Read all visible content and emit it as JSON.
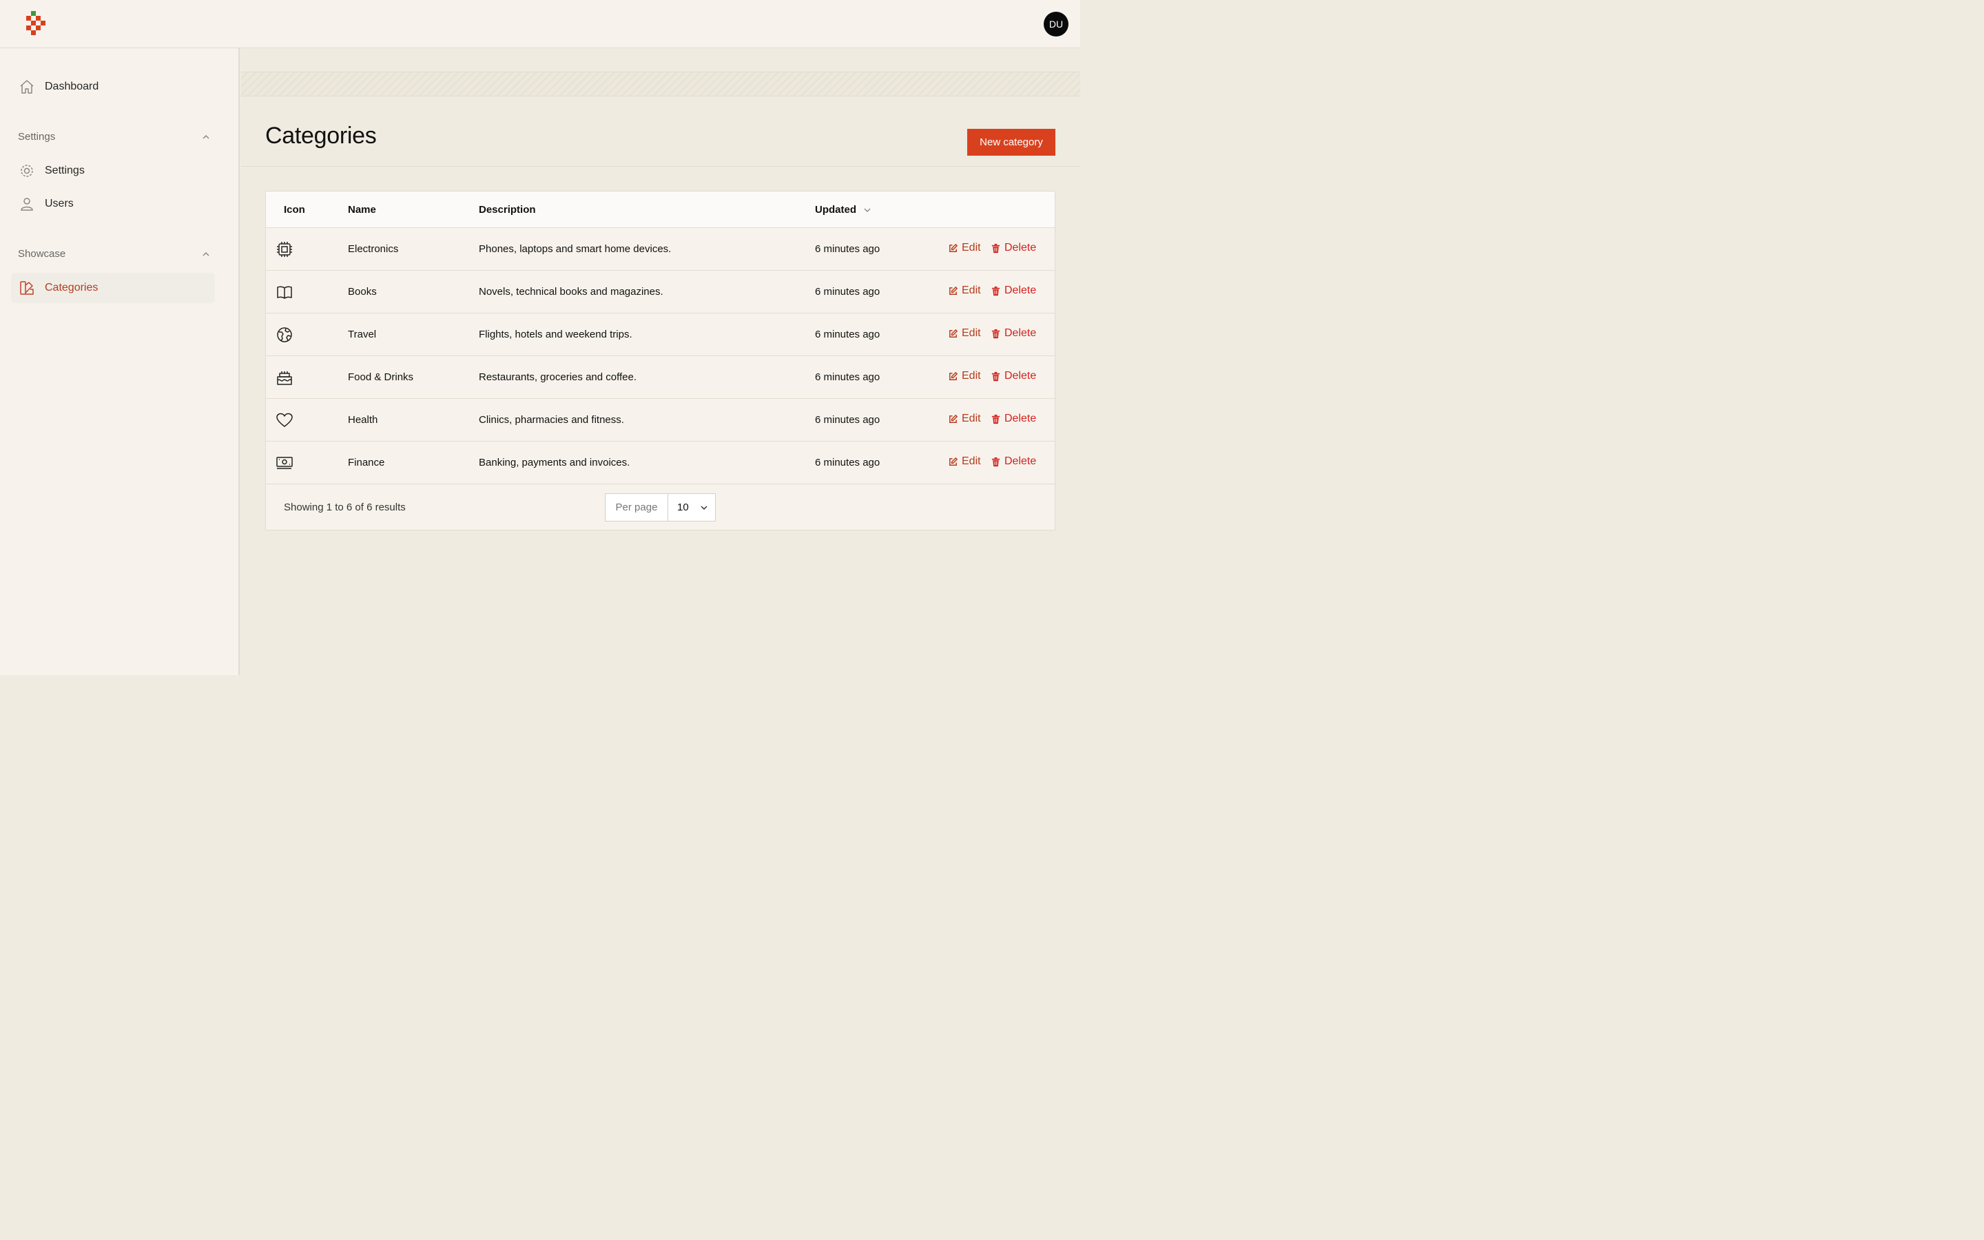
{
  "header": {
    "avatar_initials": "DU"
  },
  "sidebar": {
    "dashboard_label": "Dashboard",
    "groups": [
      {
        "label": "Settings",
        "items": [
          "Settings",
          "Users"
        ]
      },
      {
        "label": "Showcase",
        "items": [
          "Categories"
        ]
      }
    ],
    "active_item": "Categories"
  },
  "page": {
    "title": "Categories",
    "new_button": "New category"
  },
  "table": {
    "columns": [
      "Icon",
      "Name",
      "Description",
      "Updated"
    ],
    "sort_icon": "chevron-down-icon",
    "rows": [
      {
        "icon": "chip-icon",
        "name": "Electronics",
        "description": "Phones, laptops and smart home devices.",
        "updated": "6 minutes ago",
        "edit": "Edit",
        "delete": "Delete"
      },
      {
        "icon": "book-icon",
        "name": "Books",
        "description": "Novels, technical books and magazines.",
        "updated": "6 minutes ago",
        "edit": "Edit",
        "delete": "Delete"
      },
      {
        "icon": "globe-icon",
        "name": "Travel",
        "description": "Flights, hotels and weekend trips.",
        "updated": "6 minutes ago",
        "edit": "Edit",
        "delete": "Delete"
      },
      {
        "icon": "cake-icon",
        "name": "Food & Drinks",
        "description": "Restaurants, groceries and coffee.",
        "updated": "6 minutes ago",
        "edit": "Edit",
        "delete": "Delete"
      },
      {
        "icon": "heart-icon",
        "name": "Health",
        "description": "Clinics, pharmacies and fitness.",
        "updated": "6 minutes ago",
        "edit": "Edit",
        "delete": "Delete"
      },
      {
        "icon": "banknotes-icon",
        "name": "Finance",
        "description": "Banking, payments and invoices.",
        "updated": "6 minutes ago",
        "edit": "Edit",
        "delete": "Delete"
      }
    ],
    "footer": {
      "showing": "Showing 1 to 6 of 6 results",
      "per_page_label": "Per page",
      "per_page_value": "10"
    }
  },
  "colors": {
    "accent": "#d9411e",
    "active_text": "#b83a1f",
    "danger": "#d42020",
    "background": "#f0ebe0"
  }
}
